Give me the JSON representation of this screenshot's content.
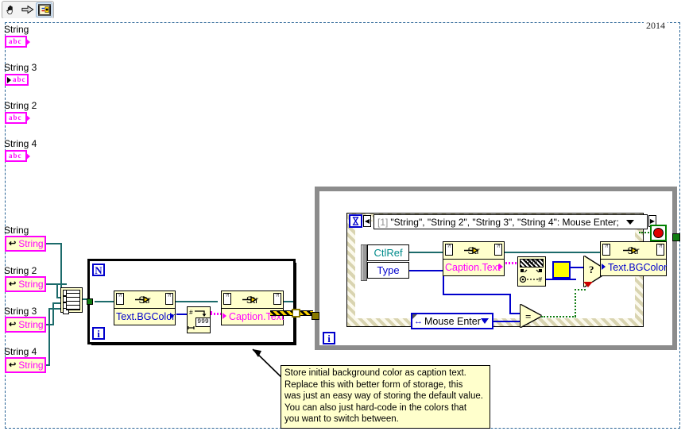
{
  "window": {
    "version_tag": "2014"
  },
  "toolbar": {
    "buttons": [
      {
        "name": "hand-tool",
        "icon": "hand-icon",
        "label": "Operate Value"
      },
      {
        "name": "run-arrow",
        "icon": "arrow-right-icon",
        "label": "Run"
      },
      {
        "name": "vi-icon",
        "icon": "vi-connector-icon",
        "label": "VI Icon"
      }
    ]
  },
  "left_terminals": [
    {
      "label": "String",
      "kind": "string-indicator",
      "glyph": "abc",
      "direction": "out"
    },
    {
      "label": "String 3",
      "kind": "string-control",
      "glyph": "abc",
      "direction": "in"
    },
    {
      "label": "String 2",
      "kind": "string-indicator",
      "glyph": "abc",
      "direction": "out"
    },
    {
      "label": "String 4",
      "kind": "string-indicator",
      "glyph": "abc",
      "direction": "out"
    }
  ],
  "refnum_terminals": [
    {
      "label": "String",
      "value": "String"
    },
    {
      "label": "String 2",
      "value": "String"
    },
    {
      "label": "String 3",
      "value": "String"
    },
    {
      "label": "String 4",
      "value": "String"
    }
  ],
  "build_array": {
    "name": "build-array-function",
    "tooltip": "Build Array"
  },
  "for_loop": {
    "count_terminal": "N",
    "index_terminal": "i",
    "property_nodes": [
      {
        "name": "property-node-text-bgcolor-read",
        "header": "Str",
        "property": "Text.BGColor",
        "mode": "read"
      },
      {
        "name": "property-node-caption-text-write",
        "header": "Str",
        "property": "Caption.Text",
        "mode": "write"
      }
    ],
    "number_to_string": {
      "name": "number-to-decimal-string",
      "display": "999"
    }
  },
  "while_loop": {
    "index_terminal": "i"
  },
  "event_structure": {
    "case_title": "[1] \"String\", \"String 2\", \"String 3\", \"String 4\": Mouse Enter;",
    "case_index": "[1]",
    "case_text": "\"String\", \"String 2\", \"String 3\", \"String 4\": Mouse Enter;",
    "event_data_node": [
      {
        "label": "CtlRef",
        "color": "#008b8b"
      },
      {
        "label": "Type",
        "color": "#0000cc"
      }
    ],
    "property_nodes": [
      {
        "name": "property-node-caption-text-read",
        "header": "Str",
        "property": "Caption.Text",
        "mode": "read"
      },
      {
        "name": "property-node-text-bgcolor-write",
        "header": "Str",
        "property": "Text.BGColor",
        "mode": "write"
      }
    ],
    "scan_from_string": {
      "name": "scan-from-string",
      "display": "999"
    },
    "enum_constant": {
      "name": "event-type-enum-constant",
      "value": "Mouse Enter"
    },
    "equal_node": {
      "name": "equal-comparison",
      "glyph": "="
    },
    "select_node": {
      "name": "select-function",
      "glyph": "?"
    },
    "color_constant": {
      "name": "color-box-constant",
      "color": "#ffff00"
    },
    "stop_button": {
      "name": "stop-button",
      "color": "#e00000"
    }
  },
  "comment": {
    "name": "free-label-comment",
    "text": "Store initial background color as caption text.\nReplace this with better form of storage, this\nwas just an easy way of storing the default value.\nYou can also just hard-code in the colors that\nyou want to switch between."
  },
  "colors": {
    "wire_string": "#1c6b6b",
    "wire_number": "#0000cc",
    "wire_bool": "#107c10",
    "wire_refnum_array": "#ffd400",
    "property_node_bg": "#ffffcc",
    "terminal_border": "#ff00ff",
    "structure_gray": "#8c8c8c",
    "event_border": "#d9d4b0"
  }
}
